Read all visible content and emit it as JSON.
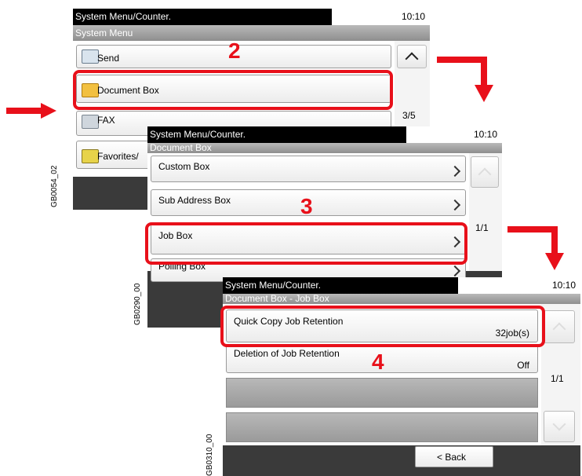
{
  "screen1": {
    "title": "System Menu/Counter.",
    "time": "10:10",
    "subtitle": "System Menu",
    "items": [
      {
        "label": "Send",
        "icon": "send-icon"
      },
      {
        "label": "Document Box",
        "icon": "document-box-icon"
      },
      {
        "label": "FAX",
        "icon": "fax-icon"
      },
      {
        "label": "Favorites/",
        "icon": "favorites-icon"
      }
    ],
    "page": "3/5",
    "step": "2",
    "code": "GB0054_02"
  },
  "screen2": {
    "title": "System Menu/Counter.",
    "time": "10:10",
    "subtitle": "Document Box",
    "items": [
      {
        "label": "Custom Box"
      },
      {
        "label": "Sub Address Box"
      },
      {
        "label": "Job Box"
      },
      {
        "label": "Polling Box"
      }
    ],
    "page": "1/1",
    "step": "3",
    "code": "GB0290_00"
  },
  "screen3": {
    "title": "System Menu/Counter.",
    "time": "10:10",
    "subtitle": "Document Box - Job Box",
    "items": [
      {
        "label": "Quick Copy Job Retention",
        "value": "32job(s)"
      },
      {
        "label": "Deletion of Job Retention",
        "value": "Off"
      }
    ],
    "page": "1/1",
    "back_label": "< Back",
    "step": "4",
    "code": "GB0310_00"
  },
  "colors": {
    "accent_red": "#e8101a"
  }
}
